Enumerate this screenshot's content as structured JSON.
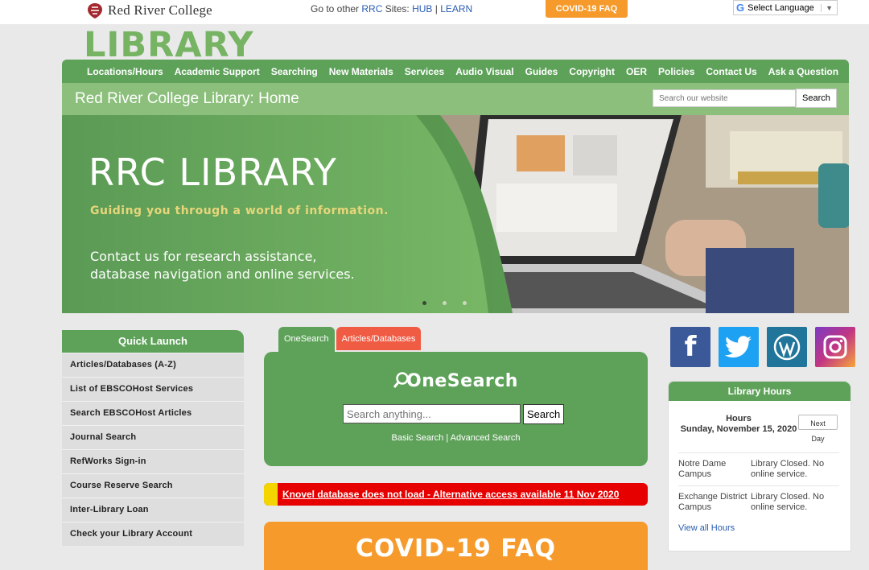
{
  "topbar": {
    "logo_brand": "Red River College",
    "logo_prefix": "R",
    "other_sites_prefix": "Go to other ",
    "rrc_label": "RRC",
    "sites_label": " Sites: ",
    "hub_label": "HUB",
    "separator": " | ",
    "learn_label": "LEARN",
    "covid_button": "COVID-19 FAQ",
    "translate_label": "Select Language",
    "translate_g": "G"
  },
  "library_heading": "LIBRARY",
  "nav": {
    "items": [
      "Locations/Hours",
      "Academic Support",
      "Searching",
      "New Materials",
      "Services",
      "Audio Visual",
      "Guides",
      "Copyright",
      "OER",
      "Policies",
      "Contact Us",
      "Ask a Question"
    ]
  },
  "title_bar": {
    "page_title": "Red River College Library: Home",
    "search_placeholder": "Search our website",
    "search_button": "Search"
  },
  "hero": {
    "title": "RRC LIBRARY",
    "tagline": "Guiding you through a world of information.",
    "contact": "Contact us for research assistance, database navigation and online services.",
    "slide_count": 3,
    "active_slide": 1
  },
  "quick_launch": {
    "title": "Quick Launch",
    "items": [
      "Articles/Databases (A-Z)",
      "List of EBSCOHost Services",
      "Search EBSCOHost Articles",
      "Journal Search",
      "RefWorks Sign-in",
      "Course Reserve Search",
      "Inter-Library Loan",
      "Check your Library Account"
    ]
  },
  "onesearch": {
    "tab_active": "OneSearch",
    "tab_other": "Articles/Databases",
    "logo_text": "OneSearch",
    "input_placeholder": "Search anything...",
    "search_button": "Search",
    "basic_link": "Basic Search",
    "link_separator": " | ",
    "advanced_link": "Advanced Search"
  },
  "alert": {
    "text": "Knovel database does not load - Alternative access available 11 Nov 2020"
  },
  "covid_box": {
    "text": "COVID-19 FAQ"
  },
  "social": [
    "facebook-icon",
    "twitter-icon",
    "wordpress-icon",
    "instagram-icon"
  ],
  "hours": {
    "title": "Library Hours",
    "heading": "Hours",
    "date": "Sunday, November 15, 2020",
    "next_day_button": "Next Day",
    "rows": [
      {
        "campus": "Notre Dame Campus",
        "status": "Library Closed. No online service."
      },
      {
        "campus": "Exchange District Campus",
        "status": "Library Closed. No online service."
      }
    ],
    "view_all": "View all Hours"
  },
  "colors": {
    "brand_green": "#5ea25a",
    "light_green": "#8bbf7b",
    "alert_red": "#e60000",
    "covid_orange": "#f59a2b",
    "tab_red": "#ef5b43"
  }
}
